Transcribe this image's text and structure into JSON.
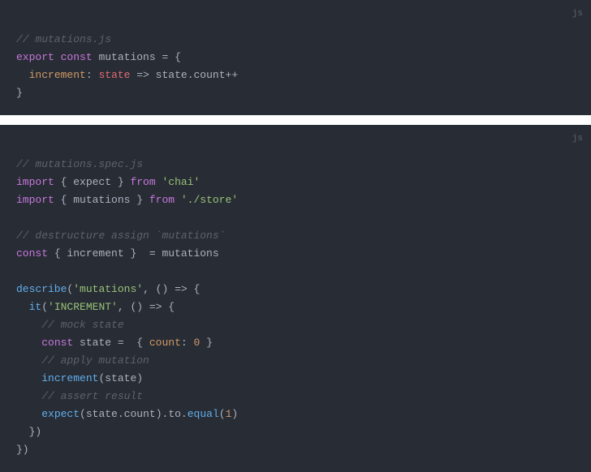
{
  "block1": {
    "lang": "js",
    "c1": "// mutations.js",
    "k_export": "export",
    "k_const": "const",
    "v_mutations": "mutations",
    "eq": " = ",
    "brace_open": "{",
    "indent": "  ",
    "a_increment": "increment",
    "colon": ": ",
    "v_state": "state",
    "arrow": " => ",
    "v_state2": "state",
    "dot": ".",
    "v_count": "count",
    "incop": "++",
    "brace_close": "}"
  },
  "block2": {
    "lang": "js",
    "c1": "// mutations.spec.js",
    "k_import": "import",
    "brace_open": " { ",
    "v_expect": "expect",
    "brace_close": " } ",
    "k_from": "from",
    "s_chai": "'chai'",
    "v_mutations": "mutations",
    "s_store": "'./store'",
    "c2": "// destructure assign `mutations`",
    "k_const": "const",
    "v_increment": "increment",
    "eq": " = ",
    "v_mutations2": "mutations",
    "f_describe": "describe",
    "paren_open": "(",
    "s_mutations": "'mutations'",
    "comma": ", ",
    "arrow_fn_open": "() ",
    "arrow": "=> ",
    "brace_open2": "{",
    "f_it": "it",
    "s_increment": "'INCREMENT'",
    "c3": "// mock state",
    "v_state": "state",
    "a_count": "count",
    "colon": ": ",
    "n_zero": "0",
    "c4": "// apply mutation",
    "f_increment": "increment",
    "c5": "// assert result",
    "f_expect": "expect",
    "dot": ".",
    "v_count": "count",
    "v_to": "to",
    "f_equal": "equal",
    "n_one": "1",
    "paren_close": ")",
    "brace_close2": "}",
    "brace_close3": "})"
  }
}
